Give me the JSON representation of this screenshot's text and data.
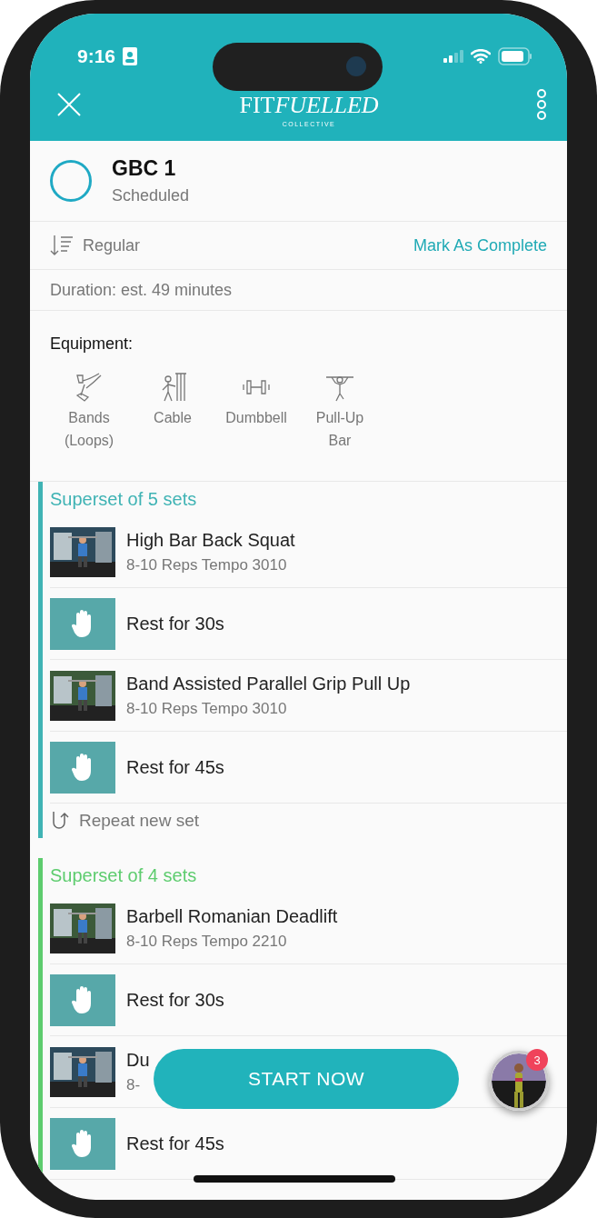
{
  "status_bar": {
    "time": "9:16"
  },
  "header": {
    "logo": "FIT",
    "logo_script": "FUELLED",
    "logo_sub": "COLLECTIVE"
  },
  "workout": {
    "title": "GBC 1",
    "status": "Scheduled",
    "completed": false
  },
  "mode": "Regular",
  "mark_complete": "Mark As Complete",
  "duration": "Duration: est. 49 minutes",
  "equipment": {
    "label": "Equipment:",
    "items": [
      {
        "kind": "bands",
        "name": "Bands (Loops)"
      },
      {
        "kind": "cable",
        "name": "Cable"
      },
      {
        "kind": "dumbbell",
        "name": "Dumbbell"
      },
      {
        "kind": "pullup",
        "name": "Pull-Up Bar"
      }
    ]
  },
  "supersets": [
    {
      "title": "Superset of 5 sets",
      "color": "#3fb3b4",
      "repeat": "Repeat new set",
      "items": [
        {
          "kind": "exercise",
          "name": "High Bar Back Squat",
          "detail": "8-10 Reps Tempo 3010"
        },
        {
          "kind": "rest",
          "name": "Rest for 30s"
        },
        {
          "kind": "exercise",
          "name": "Band Assisted Parallel Grip Pull Up",
          "detail": "8-10 Reps Tempo 3010"
        },
        {
          "kind": "rest",
          "name": "Rest for 45s"
        }
      ]
    },
    {
      "title": "Superset of 4 sets",
      "color": "#5dcc6e",
      "items": [
        {
          "kind": "exercise",
          "name": "Barbell Romanian Deadlift",
          "detail": "8-10 Reps Tempo 2210"
        },
        {
          "kind": "rest",
          "name": "Rest for 30s"
        },
        {
          "kind": "exercise",
          "name": "Du",
          "detail": "8-"
        },
        {
          "kind": "rest",
          "name": "Rest for 45s"
        }
      ]
    }
  ],
  "start_button": "START NOW",
  "avatar": {
    "badge": "3"
  }
}
